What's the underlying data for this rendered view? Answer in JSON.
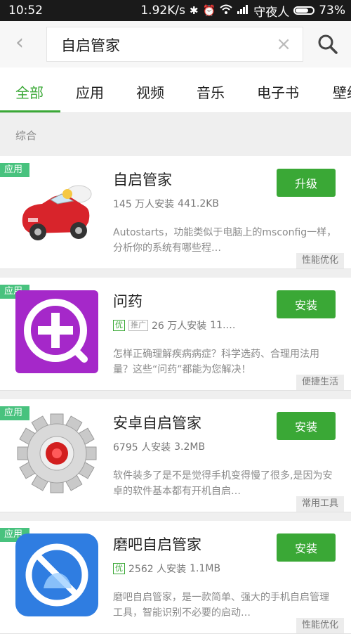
{
  "status": {
    "time": "10:52",
    "speed": "1.92K/s",
    "carrier": "守夜人",
    "battery": "73%",
    "battery_level": 0.73
  },
  "search": {
    "back": "‹",
    "query": "自启管家",
    "clear": "×"
  },
  "tabs": [
    "全部",
    "应用",
    "视频",
    "音乐",
    "电子书",
    "壁纸"
  ],
  "section_label": "综合",
  "results": [
    {
      "tag": "应用",
      "title": "自启管家",
      "installs": "145 万人安装",
      "size": "441.2KB",
      "desc": "Autostarts，功能类似于电脑上的msconfig一样，分析你的系统有哪些程…",
      "action": "升级",
      "category": "性能优化",
      "icon": "red-car-icon"
    },
    {
      "tag": "应用",
      "title": "问药",
      "badge_you": "优",
      "badge_ad": "推广",
      "installs": "26 万人安装",
      "size": "11.…",
      "desc": "怎样正确理解疾病病症？科学选药、合理用法用量？这些“问药”都能为您解决！",
      "action": "安装",
      "category": "便捷生活",
      "icon": "medicine-plus-icon"
    },
    {
      "tag": "应用",
      "title": "安卓自启管家",
      "installs": "6795 人安装",
      "size": "3.2MB",
      "desc": "软件装多了是不是觉得手机变得慢了很多,是因为安卓的软件基本都有开机自启…",
      "action": "安装",
      "category": "常用工具",
      "icon": "gear-icon"
    },
    {
      "tag": "应用",
      "title": "磨吧自启管家",
      "badge_you": "优",
      "installs": "2562 人安装",
      "size": "1.1MB",
      "desc": "磨吧自启管家，是一款简单、强大的手机自启管理工具，智能识别不必要的启动…",
      "action": "安装",
      "category": "性能优化",
      "icon": "blocked-android-icon"
    }
  ]
}
